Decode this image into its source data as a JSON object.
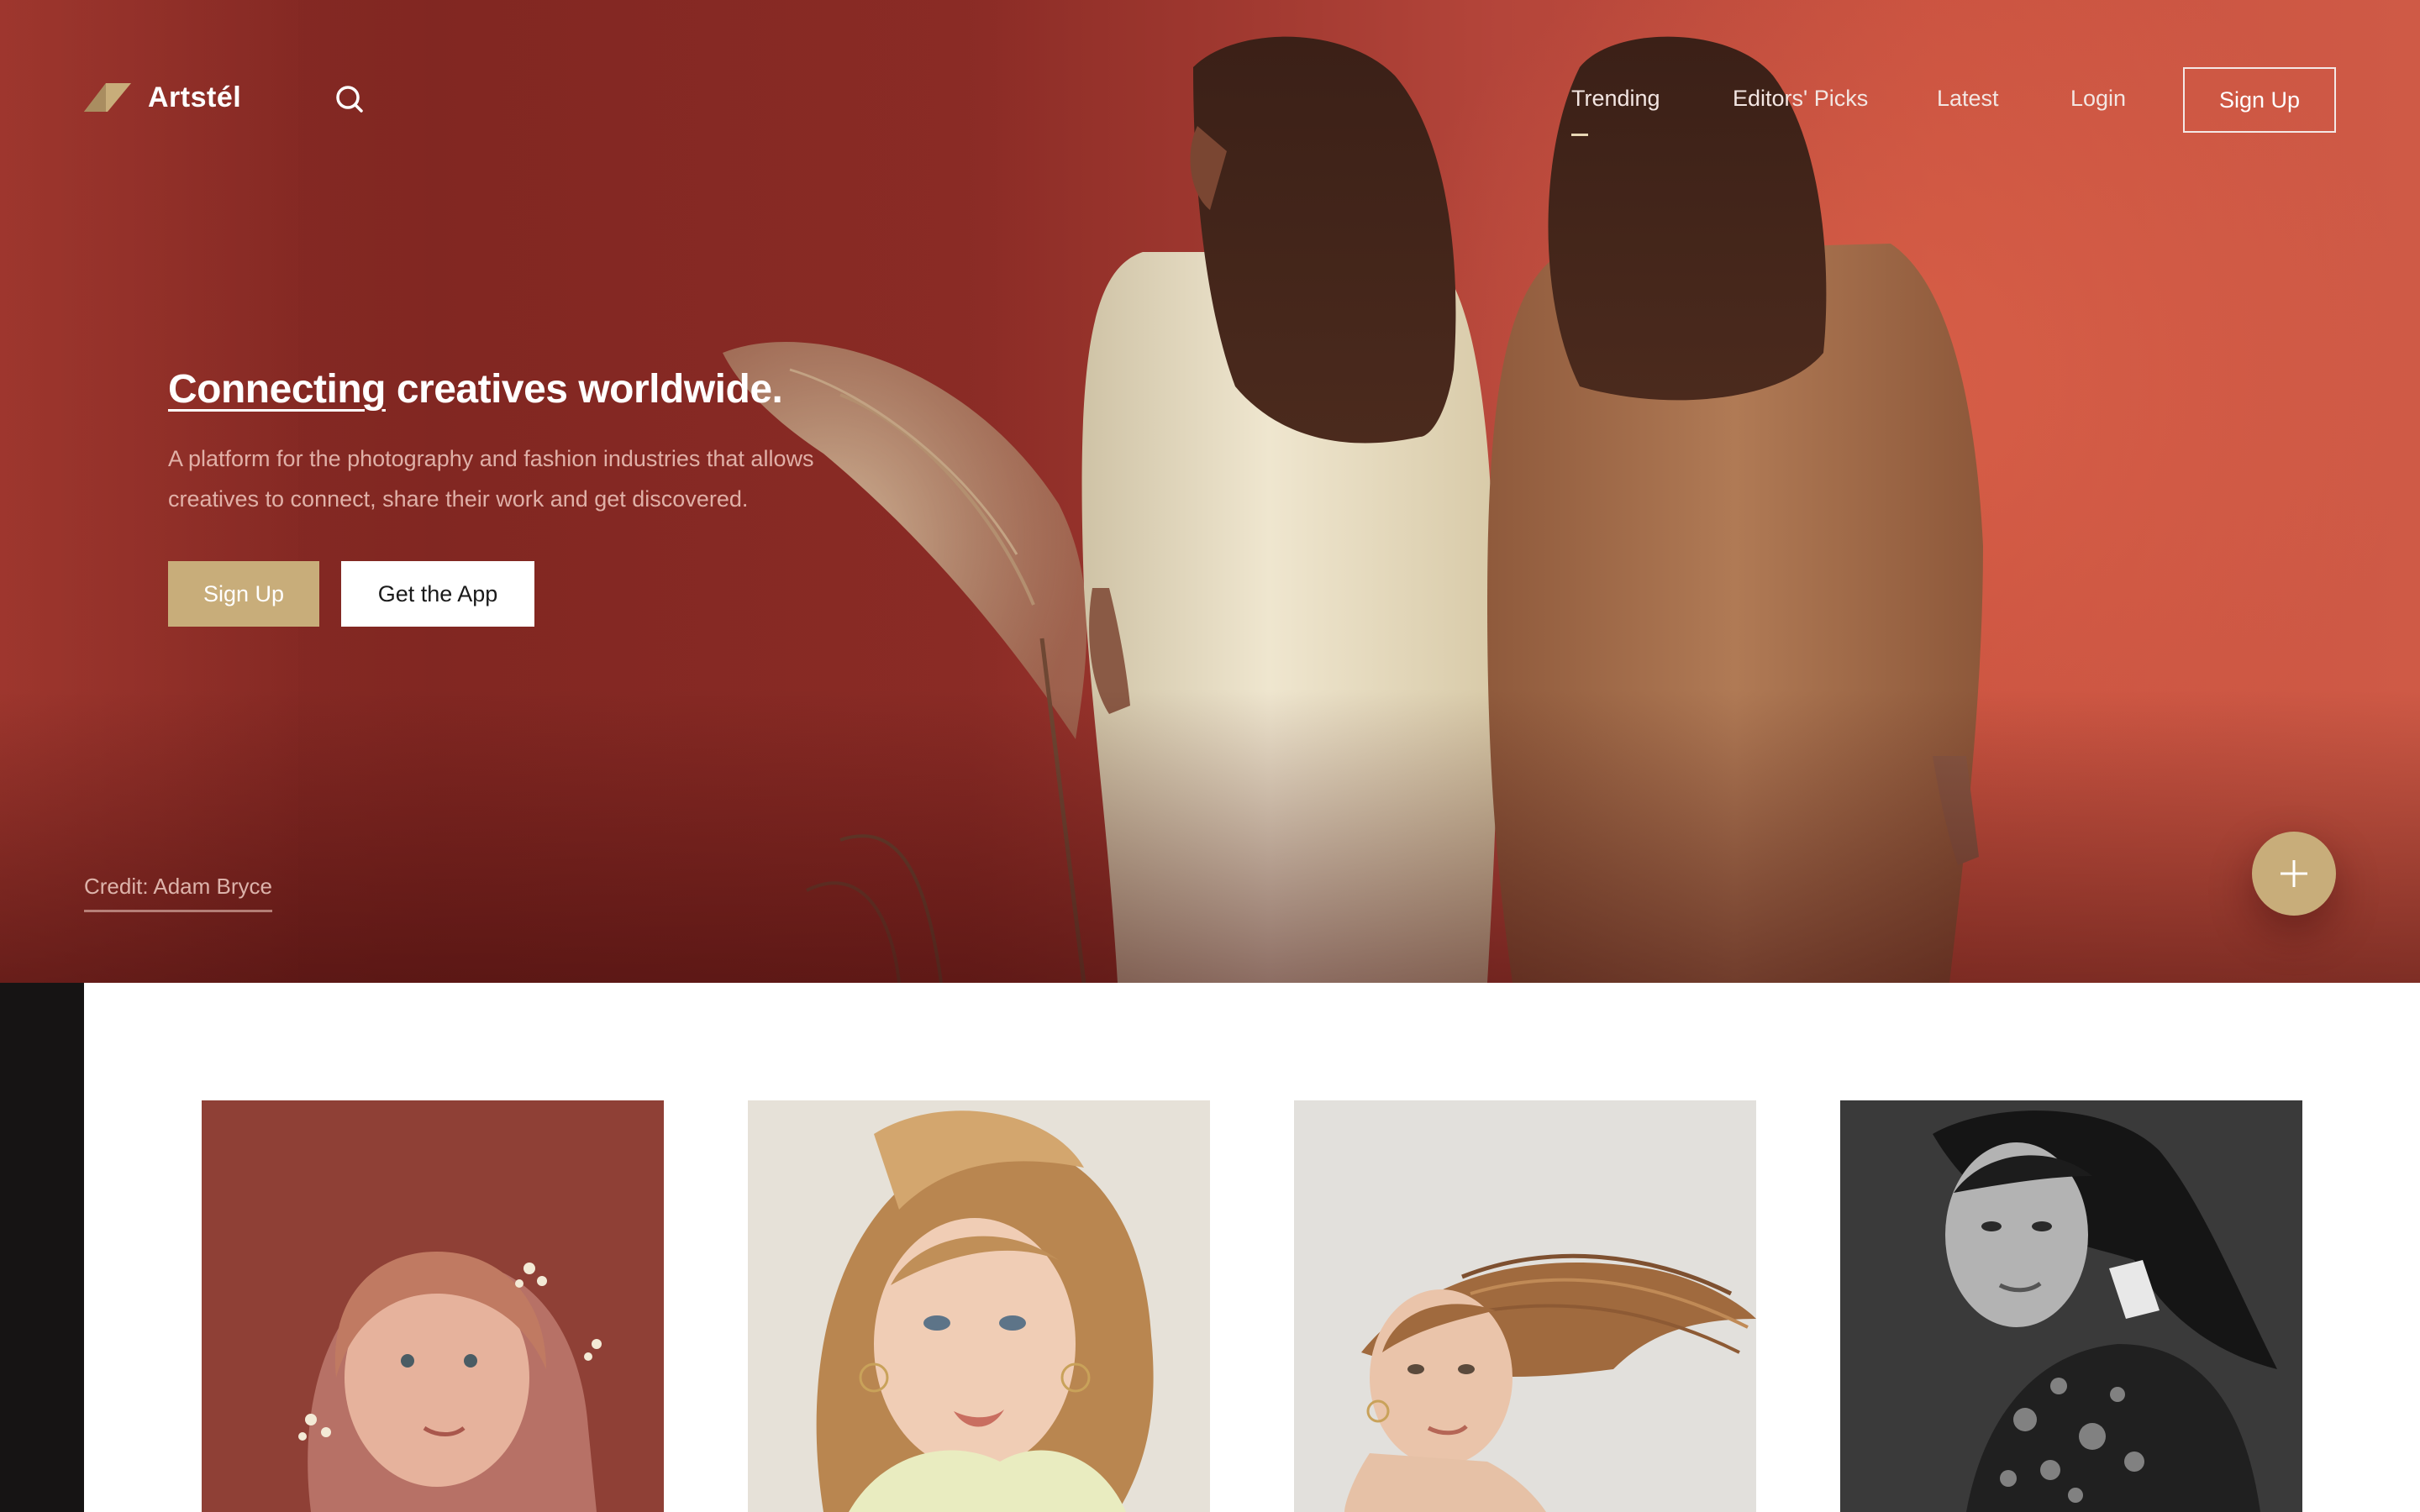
{
  "brand": {
    "name": "Artstél"
  },
  "nav": {
    "links": [
      {
        "label": "Trending",
        "active": true
      },
      {
        "label": "Editors' Picks"
      },
      {
        "label": "Latest"
      },
      {
        "label": "Login"
      }
    ],
    "signup_label": "Sign Up"
  },
  "hero": {
    "title_underlined": "Connecting",
    "title_rest": " creatives worldwide.",
    "subtitle_line1": "A platform for the photography and fashion industries that allows",
    "subtitle_line2": "creatives to connect, share their work and get discovered.",
    "primary_button": "Sign Up",
    "secondary_button": "Get the App",
    "credit": "Credit: Adam Bryce"
  },
  "icons": {
    "logo": "artstel-logo-icon",
    "search": "search-icon",
    "fab": "plus-icon"
  },
  "colors": {
    "accent": "#c8ad7a",
    "hero_red": "#b4453a",
    "dark": "#161414"
  },
  "gallery": {
    "cards": [
      {
        "subject": "girl-with-flowers-portrait"
      },
      {
        "subject": "blonde-model-portrait"
      },
      {
        "subject": "windblown-hair-portrait"
      },
      {
        "subject": "monochrome-model-portrait"
      }
    ]
  }
}
